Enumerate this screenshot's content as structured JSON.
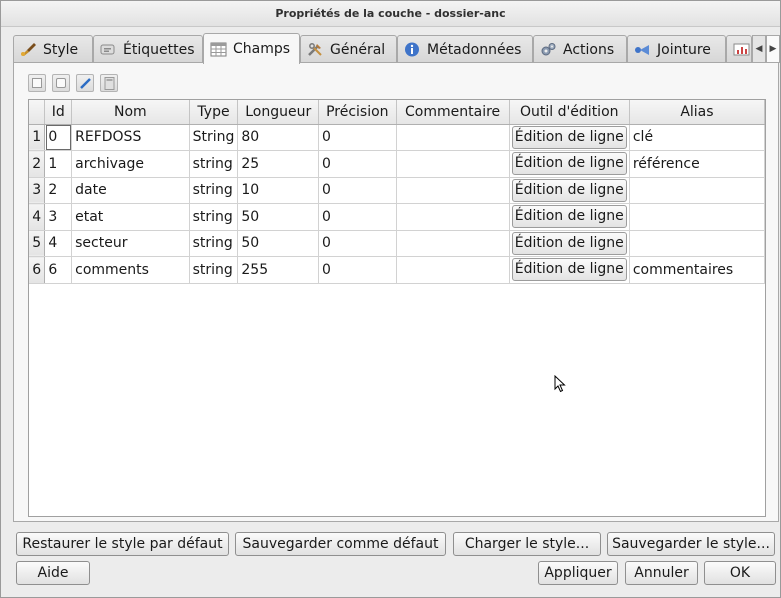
{
  "window": {
    "title": "Propriétés de la couche - dossier-anc"
  },
  "tabs": [
    {
      "label": "Style",
      "icon": "paintbrush-icon"
    },
    {
      "label": "Étiquettes",
      "icon": "label-icon"
    },
    {
      "label": "Champs",
      "icon": "table-icon",
      "active": true
    },
    {
      "label": "Général",
      "icon": "tools-icon"
    },
    {
      "label": "Métadonnées",
      "icon": "info-icon"
    },
    {
      "label": "Actions",
      "icon": "gears-icon"
    },
    {
      "label": "Jointure",
      "icon": "join-icon"
    }
  ],
  "toolbar": {
    "icons": [
      "new-field-icon",
      "delete-field-icon",
      "toggle-edit-icon",
      "field-calculator-icon"
    ]
  },
  "table": {
    "columns": [
      "",
      "Id",
      "Nom",
      "Type",
      "Longueur",
      "Précision",
      "Commentaire",
      "Outil d'édition",
      "Alias"
    ],
    "rows": [
      {
        "row": "1",
        "id": "0",
        "name": "REFDOSS",
        "type": "String",
        "length": "80",
        "precision": "0",
        "comment": "",
        "editor": "Édition de ligne",
        "alias": "clé"
      },
      {
        "row": "2",
        "id": "1",
        "name": "archivage",
        "type": "string",
        "length": "25",
        "precision": "0",
        "comment": "",
        "editor": "Édition de ligne",
        "alias": "référence"
      },
      {
        "row": "3",
        "id": "2",
        "name": "date",
        "type": "string",
        "length": "10",
        "precision": "0",
        "comment": "",
        "editor": "Édition de ligne",
        "alias": ""
      },
      {
        "row": "4",
        "id": "3",
        "name": "etat",
        "type": "string",
        "length": "50",
        "precision": "0",
        "comment": "",
        "editor": "Édition de ligne",
        "alias": ""
      },
      {
        "row": "5",
        "id": "4",
        "name": "secteur",
        "type": "string",
        "length": "50",
        "precision": "0",
        "comment": "",
        "editor": "Édition de ligne",
        "alias": ""
      },
      {
        "row": "6",
        "id": "6",
        "name": "comments",
        "type": "string",
        "length": "255",
        "precision": "0",
        "comment": "",
        "editor": "Édition de ligne",
        "alias": "commentaires"
      }
    ]
  },
  "style_buttons": {
    "restore": "Restaurer le style par défaut",
    "save_default": "Sauvegarder comme défaut",
    "load": "Charger le style...",
    "save": "Sauvegarder le style..."
  },
  "dialog_buttons": {
    "help": "Aide",
    "apply": "Appliquer",
    "cancel": "Annuler",
    "ok": "OK"
  },
  "colors": {
    "accent": "#2b6cc4",
    "window_bg": "#ececec",
    "grid_bg": "#ffffff"
  }
}
